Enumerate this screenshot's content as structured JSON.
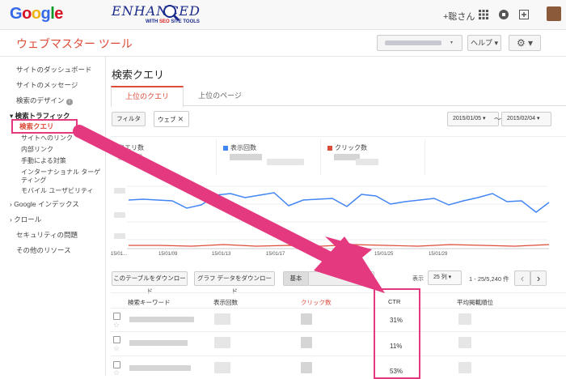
{
  "topbar": {
    "logo_letters": [
      {
        "ch": "G",
        "color": "#3369e8"
      },
      {
        "ch": "o",
        "color": "#d50f25"
      },
      {
        "ch": "o",
        "color": "#eeb211"
      },
      {
        "ch": "g",
        "color": "#3369e8"
      },
      {
        "ch": "l",
        "color": "#009925"
      },
      {
        "ch": "e",
        "color": "#d50f25"
      }
    ],
    "logo_text": "Google",
    "extension_title": "ENHANCED",
    "extension_sub_pre": "WITH ",
    "extension_sub_hl": "SEO",
    "extension_sub_post": " SITE TOOLS",
    "user": "+聡さん",
    "icons": [
      "apps-icon",
      "notifications-icon",
      "share-icon",
      "avatar"
    ]
  },
  "header": {
    "app_title": "ウェブマスター ツール",
    "help": "ヘルプ",
    "gear_label": "⚙"
  },
  "sidebar": {
    "items": [
      {
        "label": "サイトのダッシュボード"
      },
      {
        "label": "サイトのメッセージ"
      },
      {
        "label": "検索のデザイン"
      },
      {
        "label": "▾ 検索トラフィック"
      },
      {
        "label": "検索クエリ"
      },
      {
        "label": "サイトへのリンク"
      },
      {
        "label": "内部リンク"
      },
      {
        "label": "手動による対策"
      },
      {
        "label": "インターナショナル ターゲ"
      },
      {
        "label": "ティング"
      },
      {
        "label": "モバイル ユーザビリティ"
      },
      {
        "label": "› Google インデックス"
      },
      {
        "label": "› クロール"
      },
      {
        "label": "セキュリティの問題"
      },
      {
        "label": "その他のリソース"
      }
    ]
  },
  "main": {
    "title": "検索クエリ",
    "tabs": [
      {
        "label": "上位のクエリ"
      },
      {
        "label": "上位のページ"
      }
    ],
    "filter": "フィルタ",
    "filter_chip": "ウェブ",
    "date_from": "2015/01/05",
    "date_sep": "〜",
    "date_to": "2015/02/04",
    "stats": [
      {
        "label": "クエリ数",
        "color": ""
      },
      {
        "label": "表示回数",
        "color": "#4285f4"
      },
      {
        "label": "クリック数",
        "color": "#dd4b39"
      }
    ],
    "x_labels": [
      "15/01...",
      "15/01/09",
      "15/01/13",
      "15/01/17",
      "15/01/21",
      "15/01/25",
      "15/01/29"
    ],
    "download_table": "このテーブルをダウンロード",
    "download_chart": "グラフ データをダウンロード",
    "basic_btn": "基本",
    "show_label": "表示",
    "per_page": "25 列",
    "range": "1 - 25/5,240 件",
    "prev": "‹",
    "next": "›",
    "columns": [
      "検索キーワード",
      "表示回数",
      "クリック数",
      "CTR",
      "平均掲載順位"
    ],
    "ctr_values": [
      "31%",
      "11%",
      "53%"
    ]
  },
  "colors": {
    "accent": "#dd4b39",
    "highlight": "#e5397f",
    "impressions": "#4285f4",
    "clicks": "#dd4b39"
  }
}
